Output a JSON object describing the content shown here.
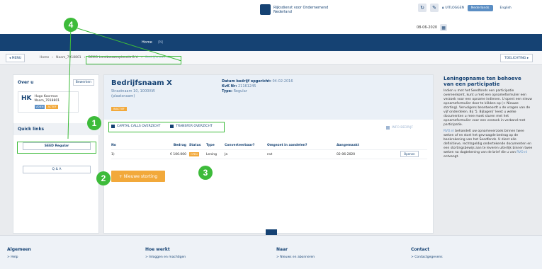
{
  "header": {
    "org_line1": "Rijksdienst voor Ondernemend",
    "org_line2": "Nederland",
    "uitloggen": "UITLOGGEN",
    "lang_active": "Nederlands",
    "lang_alt": "English",
    "date": "08-06-2020"
  },
  "nav": {
    "home": "Home",
    "second": "(N)"
  },
  "breadcrumb": {
    "menu": "MENU",
    "items": [
      "Home",
      "Naam_7918801",
      "DEMO Landbouwexploratie B.V.",
      "Bedrijfsnaam X"
    ],
    "toelichting": "TOELICHTING"
  },
  "side": {
    "title": "Over u",
    "edit": "Bewerken",
    "initials": "HK",
    "user_name": "Hugo Koorman",
    "user_id": "Naam_7918801",
    "tag1": "VDIEN",
    "tag2": "ACTIEF",
    "quick_links": "Quick links",
    "seed": "SEED Regular",
    "qa": "Q & A"
  },
  "main": {
    "name": "Bedrijfsnaam X",
    "street": "Straatnaam 10, 1000XW",
    "city": "(plaatsnaam)",
    "status": "INACTIEF",
    "founded_label": "Datum bedrijf opgericht:",
    "founded": "04-02-2016",
    "kvk_label": "KvK Nr:",
    "kvk": "21161245",
    "type_label": "Type:",
    "type": "Regular",
    "tab1": "CAPITAL CALLS OVERZICHT",
    "tab2": "TRANSFER OVERZICHT",
    "info": "INFO BEDRIJF",
    "columns": [
      "No",
      "Bedrag",
      "Status",
      "Type",
      "Converteerbaar?",
      "Omgezet in aandelen?",
      "Aangemaakt"
    ],
    "row": {
      "no": "1)",
      "bedrag": "€ 100.000",
      "status": "OPEN",
      "type": "Lening",
      "conv": "Ja",
      "omgezet": "nvt",
      "datum": "02-06-2020",
      "open": "Openen"
    },
    "new_button": "+ Nieuwe storting"
  },
  "right": {
    "title": "Leningopname ten behoeve van een participatie",
    "p1": "Indien u met het Seedfonds een participatie overeenkomt, kunt u met een opnameformulier een verzoek voor een opname indienen. U opent een nieuw opnameformulier door te klikken op (+ Nieuwe storting). Vervolgens beantwoordt u de vragen van de vijf onderdelen. Bij '5. Bijlagen)' leest u welke documenten u mee moet sturen met het opnameformulier voor een verzoek in verband met participatie.",
    "link": "RVO.nl",
    "p2": "behandelt uw opnameverzoek binnen twee weken af en stort het gevraagde bedrag op de bankrekening van het Seedfonds. U dient alle definitieve, rechtsgeldig ondertekende documenten en een stortingsbewijs aan te leveren uiterlijk binnen twee weken na dagtekening van de brief die u van",
    "link2": "RVO.nl",
    "p3": "ontvangt."
  },
  "footer": {
    "col1": {
      "title": "Algemeen",
      "link": "Help"
    },
    "col2": {
      "title": "Hoe werkt",
      "link": "Inloggen en machtigen"
    },
    "col3": {
      "title": "Naar",
      "link": "Nieuws en abonneren"
    },
    "col4": {
      "title": "Contact",
      "link": "Contactgegevens"
    }
  },
  "callouts": [
    "1",
    "2",
    "3",
    "4"
  ],
  "colors": {
    "primary": "#154273",
    "accent": "#f2a93b",
    "callout": "#3dbb3a"
  }
}
